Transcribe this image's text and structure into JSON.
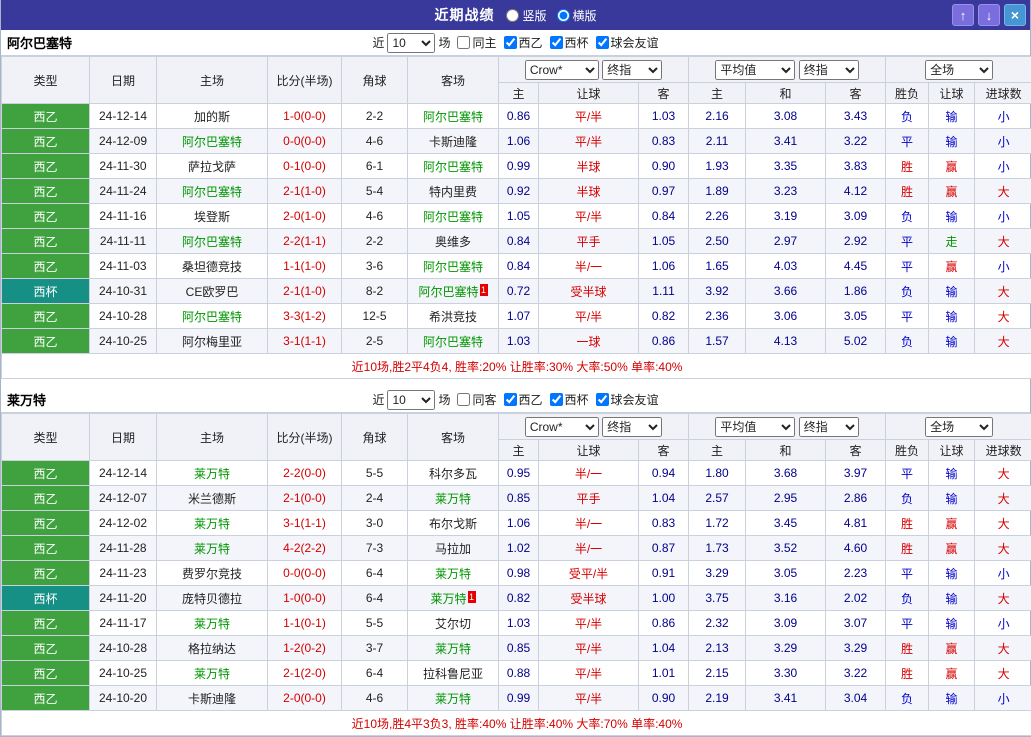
{
  "colors": {
    "topbar_bg": "#39399b",
    "league_bg": "#3fa23f",
    "cup_bg": "#168f85",
    "focus_team": "#009600",
    "score_red": "#d60000",
    "handicap_red": "#d60000",
    "odds_blue": "#00008c",
    "win_red": "#d60000",
    "lose_blue": "#0000cc",
    "walk_green": "#009600",
    "summary_red": "#d40000"
  },
  "topbar": {
    "title": "近期战绩",
    "view_options": [
      {
        "label": "竖版",
        "selected": false
      },
      {
        "label": "横版",
        "selected": true
      }
    ],
    "buttons": {
      "up": "↑",
      "down": "↓",
      "close": "×"
    }
  },
  "labels": {
    "near": "近",
    "games": "场",
    "bookmaker": "Crow*",
    "final_index": "终指",
    "average": "平均值",
    "full_match": "全场"
  },
  "columns": {
    "type": "类型",
    "date": "日期",
    "home": "主场",
    "score": "比分(半场)",
    "corner": "角球",
    "away": "客场",
    "odds_home": "主",
    "odds_handicap": "让球",
    "odds_away": "客",
    "avg_home": "主",
    "avg_draw": "和",
    "avg_away": "客",
    "result": "胜负",
    "handicap_result": "让球",
    "goals": "进球数"
  },
  "sections": [
    {
      "team": "阿尔巴塞特",
      "filter": {
        "count": "10",
        "same": {
          "label": "同主",
          "checked": false
        },
        "leagues": [
          {
            "label": "西乙",
            "checked": true
          },
          {
            "label": "西杯",
            "checked": true
          },
          {
            "label": "球会友谊",
            "checked": true
          }
        ]
      },
      "rows": [
        {
          "type": "西乙",
          "date": "24-12-14",
          "home": "加的斯",
          "home_focus": false,
          "score": "1-0(0-0)",
          "corner": "2-2",
          "away": "阿尔巴塞特",
          "away_focus": true,
          "odds": [
            "0.86",
            "平/半",
            "1.03"
          ],
          "avg": [
            "2.16",
            "3.08",
            "3.43"
          ],
          "result": "负",
          "handicap": "输",
          "goal": "小"
        },
        {
          "type": "西乙",
          "date": "24-12-09",
          "home": "阿尔巴塞特",
          "home_focus": true,
          "score": "0-0(0-0)",
          "corner": "4-6",
          "away": "卡斯迪隆",
          "away_focus": false,
          "odds": [
            "1.06",
            "平/半",
            "0.83"
          ],
          "avg": [
            "2.11",
            "3.41",
            "3.22"
          ],
          "result": "平",
          "handicap": "输",
          "goal": "小"
        },
        {
          "type": "西乙",
          "date": "24-11-30",
          "home": "萨拉戈萨",
          "home_focus": false,
          "score": "0-1(0-0)",
          "corner": "6-1",
          "away": "阿尔巴塞特",
          "away_focus": true,
          "odds": [
            "0.99",
            "半球",
            "0.90"
          ],
          "avg": [
            "1.93",
            "3.35",
            "3.83"
          ],
          "result": "胜",
          "handicap": "赢",
          "goal": "小"
        },
        {
          "type": "西乙",
          "date": "24-11-24",
          "home": "阿尔巴塞特",
          "home_focus": true,
          "score": "2-1(1-0)",
          "corner": "5-4",
          "away": "特内里费",
          "away_focus": false,
          "odds": [
            "0.92",
            "半球",
            "0.97"
          ],
          "avg": [
            "1.89",
            "3.23",
            "4.12"
          ],
          "result": "胜",
          "handicap": "赢",
          "goal": "大"
        },
        {
          "type": "西乙",
          "date": "24-11-16",
          "home": "埃登斯",
          "home_focus": false,
          "score": "2-0(1-0)",
          "corner": "4-6",
          "away": "阿尔巴塞特",
          "away_focus": true,
          "odds": [
            "1.05",
            "平/半",
            "0.84"
          ],
          "avg": [
            "2.26",
            "3.19",
            "3.09"
          ],
          "result": "负",
          "handicap": "输",
          "goal": "小"
        },
        {
          "type": "西乙",
          "date": "24-11-11",
          "home": "阿尔巴塞特",
          "home_focus": true,
          "score": "2-2(1-1)",
          "corner": "2-2",
          "away": "奥维多",
          "away_focus": false,
          "odds": [
            "0.84",
            "平手",
            "1.05"
          ],
          "avg": [
            "2.50",
            "2.97",
            "2.92"
          ],
          "result": "平",
          "handicap": "走",
          "goal": "大"
        },
        {
          "type": "西乙",
          "date": "24-11-03",
          "home": "桑坦德竞技",
          "home_focus": false,
          "score": "1-1(1-0)",
          "corner": "3-6",
          "away": "阿尔巴塞特",
          "away_focus": true,
          "odds": [
            "0.84",
            "半/一",
            "1.06"
          ],
          "avg": [
            "1.65",
            "4.03",
            "4.45"
          ],
          "result": "平",
          "handicap": "赢",
          "goal": "小"
        },
        {
          "type": "西杯",
          "date": "24-10-31",
          "home": "CE欧罗巴",
          "home_focus": false,
          "score": "2-1(1-0)",
          "corner": "8-2",
          "away": "阿尔巴塞特",
          "away_focus": true,
          "away_red": "1",
          "odds": [
            "0.72",
            "受半球",
            "1.11"
          ],
          "avg": [
            "3.92",
            "3.66",
            "1.86"
          ],
          "result": "负",
          "handicap": "输",
          "goal": "大"
        },
        {
          "type": "西乙",
          "date": "24-10-28",
          "home": "阿尔巴塞特",
          "home_focus": true,
          "score": "3-3(1-2)",
          "corner": "12-5",
          "away": "希洪竞技",
          "away_focus": false,
          "odds": [
            "1.07",
            "平/半",
            "0.82"
          ],
          "avg": [
            "2.36",
            "3.06",
            "3.05"
          ],
          "result": "平",
          "handicap": "输",
          "goal": "大"
        },
        {
          "type": "西乙",
          "date": "24-10-25",
          "home": "阿尔梅里亚",
          "home_focus": false,
          "score": "3-1(1-1)",
          "corner": "2-5",
          "away": "阿尔巴塞特",
          "away_focus": true,
          "odds": [
            "1.03",
            "一球",
            "0.86"
          ],
          "avg": [
            "1.57",
            "4.13",
            "5.02"
          ],
          "result": "负",
          "handicap": "输",
          "goal": "大"
        }
      ],
      "summary": "近10场,胜2平4负4, 胜率:20% 让胜率:30% 大率:50% 单率:40%"
    },
    {
      "team": "莱万特",
      "filter": {
        "count": "10",
        "same": {
          "label": "同客",
          "checked": false
        },
        "leagues": [
          {
            "label": "西乙",
            "checked": true
          },
          {
            "label": "西杯",
            "checked": true
          },
          {
            "label": "球会友谊",
            "checked": true
          }
        ]
      },
      "rows": [
        {
          "type": "西乙",
          "date": "24-12-14",
          "home": "莱万特",
          "home_focus": true,
          "score": "2-2(0-0)",
          "corner": "5-5",
          "away": "科尔多瓦",
          "away_focus": false,
          "odds": [
            "0.95",
            "半/一",
            "0.94"
          ],
          "avg": [
            "1.80",
            "3.68",
            "3.97"
          ],
          "result": "平",
          "handicap": "输",
          "goal": "大"
        },
        {
          "type": "西乙",
          "date": "24-12-07",
          "home": "米兰德斯",
          "home_focus": false,
          "score": "2-1(0-0)",
          "corner": "2-4",
          "away": "莱万特",
          "away_focus": true,
          "odds": [
            "0.85",
            "平手",
            "1.04"
          ],
          "avg": [
            "2.57",
            "2.95",
            "2.86"
          ],
          "result": "负",
          "handicap": "输",
          "goal": "大"
        },
        {
          "type": "西乙",
          "date": "24-12-02",
          "home": "莱万特",
          "home_focus": true,
          "score": "3-1(1-1)",
          "corner": "3-0",
          "away": "布尔戈斯",
          "away_focus": false,
          "odds": [
            "1.06",
            "半/一",
            "0.83"
          ],
          "avg": [
            "1.72",
            "3.45",
            "4.81"
          ],
          "result": "胜",
          "handicap": "赢",
          "goal": "大"
        },
        {
          "type": "西乙",
          "date": "24-11-28",
          "home": "莱万特",
          "home_focus": true,
          "score": "4-2(2-2)",
          "corner": "7-3",
          "away": "马拉加",
          "away_focus": false,
          "odds": [
            "1.02",
            "半/一",
            "0.87"
          ],
          "avg": [
            "1.73",
            "3.52",
            "4.60"
          ],
          "result": "胜",
          "handicap": "赢",
          "goal": "大"
        },
        {
          "type": "西乙",
          "date": "24-11-23",
          "home": "费罗尔竞技",
          "home_focus": false,
          "score": "0-0(0-0)",
          "corner": "6-4",
          "away": "莱万特",
          "away_focus": true,
          "odds": [
            "0.98",
            "受平/半",
            "0.91"
          ],
          "avg": [
            "3.29",
            "3.05",
            "2.23"
          ],
          "result": "平",
          "handicap": "输",
          "goal": "小"
        },
        {
          "type": "西杯",
          "date": "24-11-20",
          "home": "庞特贝德拉",
          "home_focus": false,
          "score": "1-0(0-0)",
          "corner": "6-4",
          "away": "莱万特",
          "away_focus": true,
          "away_red": "1",
          "odds": [
            "0.82",
            "受半球",
            "1.00"
          ],
          "avg": [
            "3.75",
            "3.16",
            "2.02"
          ],
          "result": "负",
          "handicap": "输",
          "goal": "大"
        },
        {
          "type": "西乙",
          "date": "24-11-17",
          "home": "莱万特",
          "home_focus": true,
          "score": "1-1(0-1)",
          "corner": "5-5",
          "away": "艾尔切",
          "away_focus": false,
          "odds": [
            "1.03",
            "平/半",
            "0.86"
          ],
          "avg": [
            "2.32",
            "3.09",
            "3.07"
          ],
          "result": "平",
          "handicap": "输",
          "goal": "小"
        },
        {
          "type": "西乙",
          "date": "24-10-28",
          "home": "格拉纳达",
          "home_focus": false,
          "score": "1-2(0-2)",
          "corner": "3-7",
          "away": "莱万特",
          "away_focus": true,
          "odds": [
            "0.85",
            "平/半",
            "1.04"
          ],
          "avg": [
            "2.13",
            "3.29",
            "3.29"
          ],
          "result": "胜",
          "handicap": "赢",
          "goal": "大"
        },
        {
          "type": "西乙",
          "date": "24-10-25",
          "home": "莱万特",
          "home_focus": true,
          "score": "2-1(2-0)",
          "corner": "6-4",
          "away": "拉科鲁尼亚",
          "away_focus": false,
          "odds": [
            "0.88",
            "平/半",
            "1.01"
          ],
          "avg": [
            "2.15",
            "3.30",
            "3.22"
          ],
          "result": "胜",
          "handicap": "赢",
          "goal": "大"
        },
        {
          "type": "西乙",
          "date": "24-10-20",
          "home": "卡斯迪隆",
          "home_focus": false,
          "score": "2-0(0-0)",
          "corner": "4-6",
          "away": "莱万特",
          "away_focus": true,
          "odds": [
            "0.99",
            "平/半",
            "0.90"
          ],
          "avg": [
            "2.19",
            "3.41",
            "3.04"
          ],
          "result": "负",
          "handicap": "输",
          "goal": "小"
        }
      ],
      "summary": "近10场,胜4平3负3, 胜率:40% 让胜率:40% 大率:70% 单率:40%"
    }
  ]
}
